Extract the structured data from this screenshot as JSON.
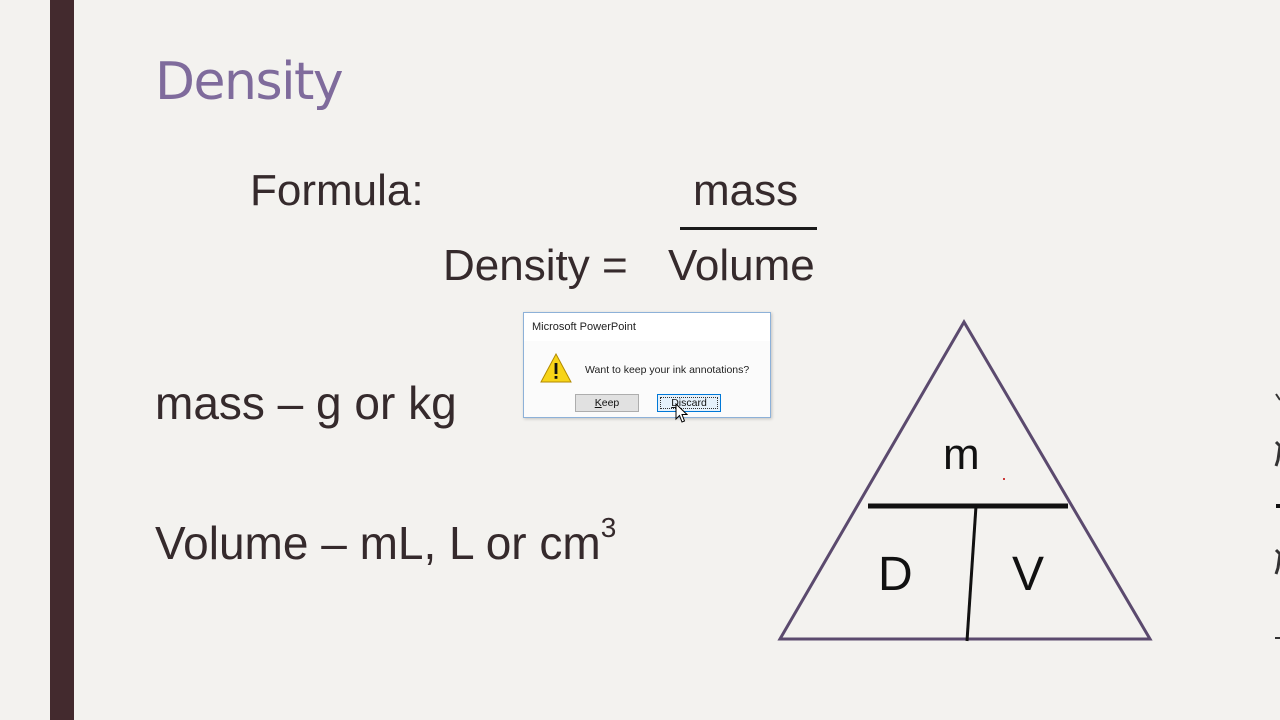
{
  "slide": {
    "title": "Density",
    "formula_label": "Formula:",
    "fraction": {
      "lhs": "Density =",
      "numerator": "mass",
      "denominator": "Volume"
    },
    "mass_units": "mass – g or kg",
    "volume_units_text": "Volume – mL, L or cm",
    "volume_units_sup": "3",
    "triangle": {
      "top": "m",
      "bottom_left": "D",
      "bottom_right": "V"
    },
    "colors": {
      "background": "#f3f2ef",
      "left_bar": "#432a2e",
      "title": "#7f6b9c",
      "body_text": "#352a2c",
      "triangle_outline": "#5b4a6e"
    }
  },
  "dialog": {
    "title": "Microsoft PowerPoint",
    "message": "Want to keep your ink annotations?",
    "icon": "warning-icon",
    "buttons": {
      "keep": {
        "prefix": "",
        "mnemonic": "K",
        "rest": "eep"
      },
      "discard": {
        "prefix": "",
        "mnemonic": "D",
        "rest": "iscard"
      }
    },
    "focused_button": "Discard"
  }
}
